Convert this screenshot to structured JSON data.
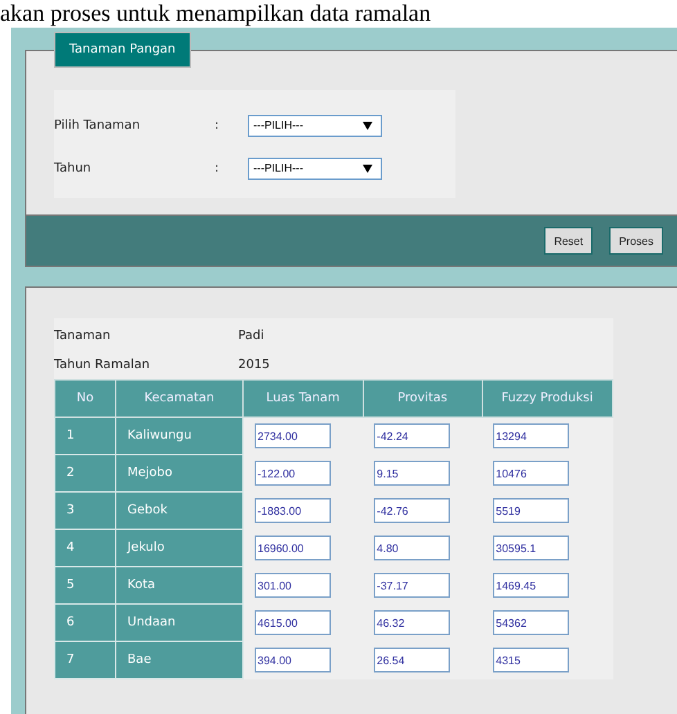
{
  "caption": "akan proses untuk menampilkan data ramalan",
  "form": {
    "tab": "Tanaman Pangan",
    "fields": [
      {
        "label": "Pilih Tanaman",
        "separator": ":",
        "value": "---PILIH---"
      },
      {
        "label": "Tahun",
        "separator": ":",
        "value": "---PILIH---"
      }
    ],
    "buttons": [
      "Reset",
      "Proses"
    ]
  },
  "result": {
    "info": [
      {
        "label": "Tanaman",
        "value": "Padi"
      },
      {
        "label": "Tahun Ramalan",
        "value": "2015"
      }
    ],
    "columns": [
      "No",
      "Kecamatan",
      "Luas Tanam",
      "Provitas",
      "Fuzzy Produksi"
    ],
    "rows": [
      {
        "no": "1",
        "kecamatan": "Kaliwungu",
        "values": [
          "2734.00",
          "-42.24",
          "13294"
        ]
      },
      {
        "no": "2",
        "kecamatan": "Mejobo",
        "values": [
          "-122.00",
          "9.15",
          "10476"
        ]
      },
      {
        "no": "3",
        "kecamatan": "Gebok",
        "values": [
          "-1883.00",
          "-42.76",
          "5519"
        ]
      },
      {
        "no": "4",
        "kecamatan": "Jekulo",
        "values": [
          "16960.00",
          "4.80",
          "30595.1"
        ]
      },
      {
        "no": "5",
        "kecamatan": "Kota",
        "values": [
          "301.00",
          "-37.17",
          "1469.45"
        ]
      },
      {
        "no": "6",
        "kecamatan": "Undaan",
        "values": [
          "4615.00",
          "46.32",
          "54362"
        ]
      },
      {
        "no": "7",
        "kecamatan": "Bae",
        "values": [
          "394.00",
          "26.54",
          "4315"
        ]
      }
    ]
  }
}
